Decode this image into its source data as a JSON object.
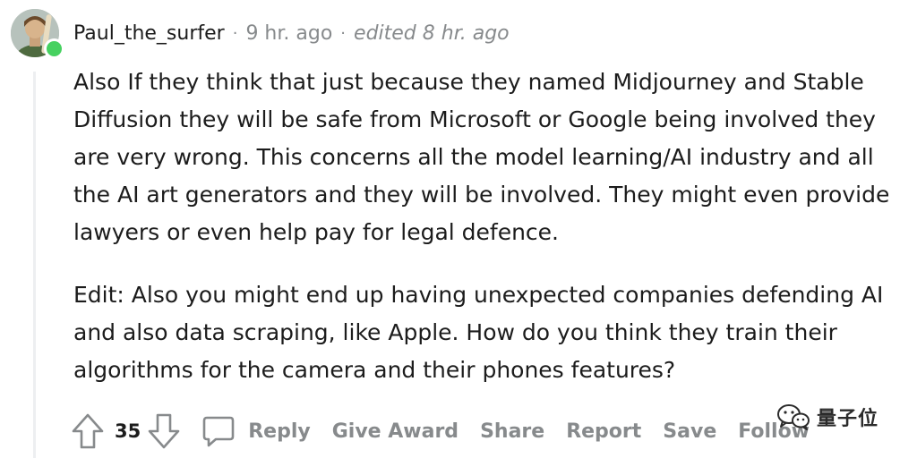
{
  "comment": {
    "author": "Paul_the_surfer",
    "separator": "·",
    "time": "9 hr. ago",
    "edited": "edited 8 hr. ago",
    "paragraphs": [
      "Also If they think that just because they named Midjourney and Stable Diffusion they will be safe from Microsoft or Google being involved they are very wrong. This concerns all the model learning/AI industry and all the AI art generators and they will be involved. They might even provide lawyers or even help pay for legal defence.",
      "Edit: Also you might end up having unexpected companies defending AI and also data scraping, like Apple. How do you think they train their algorithms for the camera and their phones features?"
    ],
    "score": "35",
    "actions": {
      "reply": "Reply",
      "give_award": "Give Award",
      "share": "Share",
      "report": "Report",
      "save": "Save",
      "follow": "Follow"
    }
  },
  "watermark": {
    "text": "量子位",
    "icon": "wechat-icon"
  },
  "colors": {
    "meta_gray": "#878a8c",
    "text": "#1c1c1c",
    "online": "#46d160",
    "thread_line": "#edeff1"
  }
}
